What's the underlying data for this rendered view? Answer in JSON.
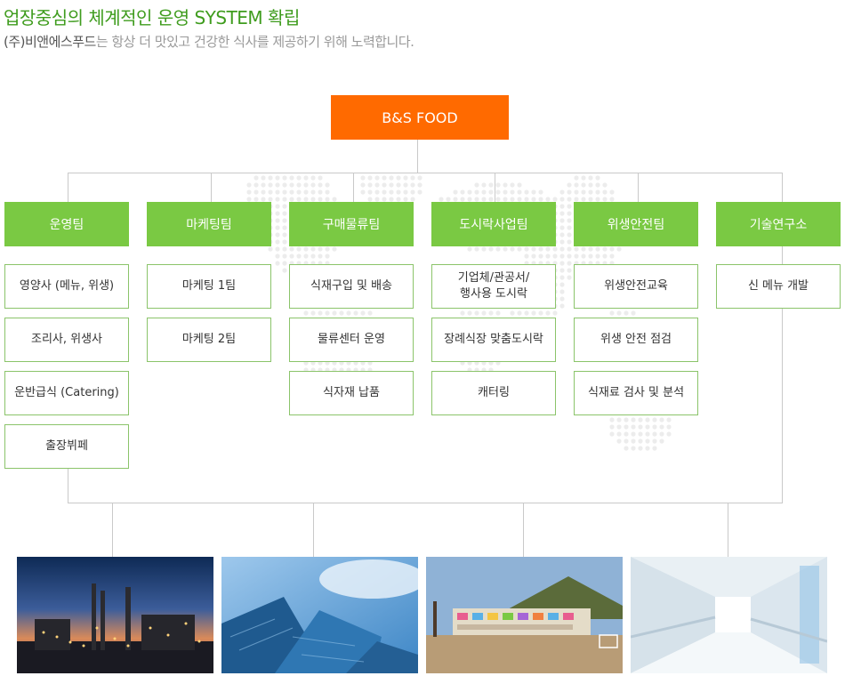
{
  "header": {
    "title": "업장중심의 체계적인 운영 SYSTEM 확립",
    "subtitle_company": "(주)비앤에스푸드",
    "subtitle_rest": "는 항상 더 맛있고 건강한 식사를 제공하기 위해 노력합니다."
  },
  "org": {
    "root": "B&S FOOD",
    "teams": [
      {
        "name": "운영팀",
        "tasks": [
          "영양사 (메뉴, 위생)",
          "조리사, 위생사",
          "운반급식 (Catering)",
          "출장뷔페"
        ]
      },
      {
        "name": "마케팅팀",
        "tasks": [
          "마케팅 1팀",
          "마케팅 2팀"
        ]
      },
      {
        "name": "구매물류팀",
        "tasks": [
          "식재구입 및 배송",
          "물류센터 운영",
          "식자재 납품"
        ]
      },
      {
        "name": "도시락사업팀",
        "tasks": [
          "기업체/관공서/\n행사용 도시락",
          "장례식장 맞춤도시락",
          "캐터링"
        ]
      },
      {
        "name": "위생안전팀",
        "tasks": [
          "위생안전교육",
          "위생 안전 점검",
          "식재료 검사 및 분석"
        ]
      },
      {
        "name": "기술연구소",
        "tasks": [
          "신 메뉴 개발"
        ]
      }
    ]
  },
  "photos": [
    {
      "subject": "industrial-plant-at-dusk"
    },
    {
      "subject": "glass-office-building"
    },
    {
      "subject": "school-building"
    },
    {
      "subject": "hospital-corridor"
    }
  ],
  "colors": {
    "title": "#3f9c1e",
    "root_box": "#ff6a00",
    "team_box": "#7ac943",
    "task_border": "#8bc46a",
    "connector": "#c9c9c9"
  }
}
